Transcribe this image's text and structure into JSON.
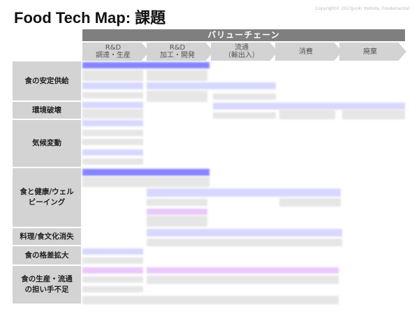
{
  "title": "Food Tech Map: 課題",
  "copyright": "Copyright© 2023Junki Yoshida, Foodamental",
  "value_chain": {
    "label": "バリューチェーン",
    "stages": [
      {
        "line1": "R&D",
        "line2": "調達・生産"
      },
      {
        "line1": "R&D",
        "line2": "加工・開発"
      },
      {
        "line1": "流通",
        "line2": "（輸出入）"
      },
      {
        "line1": "消費",
        "line2": ""
      },
      {
        "line1": "廃棄",
        "line2": ""
      }
    ]
  },
  "issues": [
    "食の安定供給",
    "環境破壊",
    "気候変動",
    "食と健康/ウェルビーイング",
    "料理/食文化消失",
    "食の格差拡大",
    "食の生産・流通の担い手不足"
  ]
}
